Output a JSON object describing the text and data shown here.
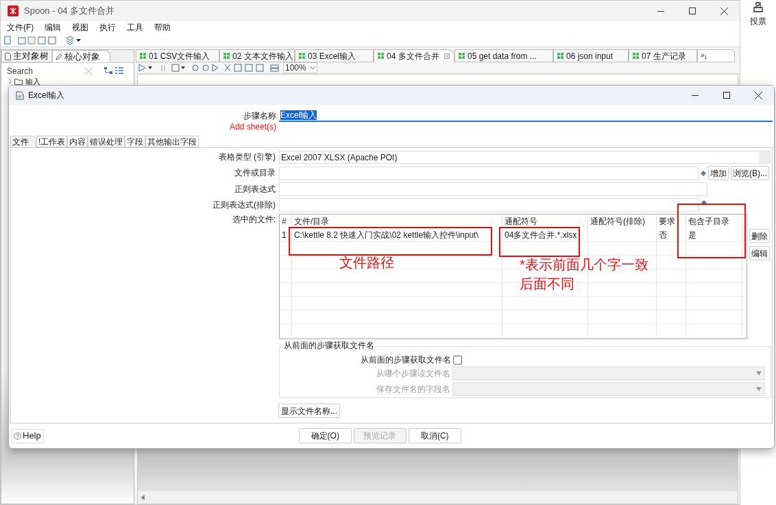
{
  "window": {
    "title": "Spoon - 04 多文件合并"
  },
  "menu": [
    "文件(F)",
    "编辑",
    "视图",
    "执行",
    "工具",
    "帮助"
  ],
  "side_app": {
    "label": "投票"
  },
  "left_tabs": [
    {
      "label": "主对象树",
      "selected": false
    },
    {
      "label": "核心对象",
      "selected": true
    }
  ],
  "search": {
    "placeholder": "Search"
  },
  "tree": [
    {
      "label": "输入",
      "expanded": false
    }
  ],
  "doc_tabs": [
    {
      "label": "01 CSV文件输入",
      "selected": false
    },
    {
      "label": "02 文本文件输入",
      "selected": false
    },
    {
      "label": "03 Excel输入",
      "selected": false
    },
    {
      "label": "04 多文件合并",
      "selected": true
    },
    {
      "label": "05 get data from ...",
      "selected": false
    },
    {
      "label": "06 json input",
      "selected": false
    },
    {
      "label": "07 生产记录",
      "selected": false
    }
  ],
  "more_tabs": "»$_{1}$",
  "zoom": "100%",
  "dialog": {
    "title": "Excel输入",
    "step_name_label": "步骤名称",
    "step_name": "Excel输入",
    "add_sheet": "Add sheet(s)",
    "tabs": [
      {
        "label": "文件",
        "selected": true
      },
      {
        "label": "!工作表",
        "selected": false
      },
      {
        "label": "内容",
        "selected": false
      },
      {
        "label": "错误处理",
        "selected": false
      },
      {
        "label": "字段",
        "selected": false
      },
      {
        "label": "其他输出字段",
        "selected": false
      }
    ],
    "spreadsheet_type": {
      "label": "表格类型 (引擎)",
      "value": "Excel 2007 XLSX (Apache POI)"
    },
    "file_or_dir": {
      "label": "文件或目录",
      "add": "增加",
      "browse": "浏览(B)..."
    },
    "regex": {
      "label": "正则表达式"
    },
    "regex_exclude": {
      "label": "正则表达式(排除)"
    },
    "selected_files": {
      "label": "选中的文件:",
      "columns": [
        "#",
        "文件/目录",
        "通配符号",
        "通配符号(排除)",
        "要求",
        "包含子目录"
      ],
      "rows": [
        [
          "1",
          "C:\\kettle 8.2 快速入门实战\\02 kettle输入控件\\input\\",
          "04多文件合并.*.xlsx",
          "",
          "否",
          "是"
        ]
      ],
      "delete": "删除",
      "edit": "编辑"
    },
    "from_previous": {
      "title": "从前面的步骤获取文件名",
      "checkbox_label": "从前面的步骤获取文件名",
      "checked": false,
      "fields": [
        {
          "label": "从哪个步骤读文件名",
          "disabled": true
        },
        {
          "label": "保存文件名的字段名",
          "disabled": true
        }
      ]
    },
    "show_filenames": "显示文件名称...",
    "help": "Help",
    "buttons": [
      {
        "label": "确定(O)",
        "disabled": false
      },
      {
        "label": "预览记录",
        "disabled": true
      },
      {
        "label": "取消(C)",
        "disabled": false
      }
    ]
  },
  "annotations": [
    {
      "text": "文件路径"
    },
    {
      "text": "*表示前面几个字一致"
    },
    {
      "text": "后面不同"
    }
  ]
}
